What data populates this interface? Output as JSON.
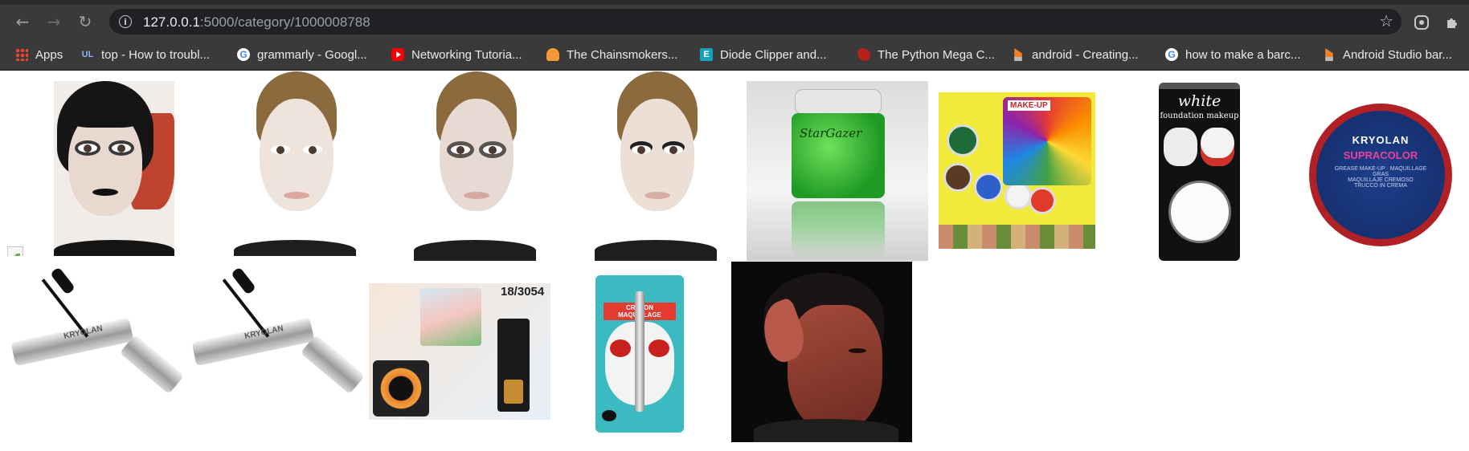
{
  "browser": {
    "url_host": "127.0.0.1",
    "url_path": ":5000/category/1000008788",
    "nav_icons": [
      "back-arrow-icon",
      "forward-arrow-icon",
      "reload-icon"
    ],
    "omnibox_icons": [
      "info-icon",
      "star-icon"
    ],
    "extension_icons": [
      "extension-app-icon",
      "puzzle-icon"
    ]
  },
  "bookmarks": [
    {
      "label": "Apps",
      "icon": "apps-grid-icon"
    },
    {
      "label": "top - How to troubl...",
      "icon": "ul-icon"
    },
    {
      "label": "grammarly - Googl...",
      "icon": "google-icon"
    },
    {
      "label": "Networking Tutoria...",
      "icon": "youtube-icon"
    },
    {
      "label": "The Chainsmokers...",
      "icon": "chainsmokers-icon"
    },
    {
      "label": "Diode Clipper and...",
      "icon": "e-icon"
    },
    {
      "label": "The Python Mega C...",
      "icon": "python-course-icon"
    },
    {
      "label": "android - Creating...",
      "icon": "stackoverflow-icon"
    },
    {
      "label": "how to make a barc...",
      "icon": "google-icon"
    },
    {
      "label": "Android Studio bar...",
      "icon": "stackoverflow-icon"
    }
  ],
  "products": {
    "items": [
      {
        "name": "goth-makeup-model"
      },
      {
        "name": "pale-foundation-model"
      },
      {
        "name": "smoky-eye-model"
      },
      {
        "name": "lashes-model"
      },
      {
        "name": "green-glitter-jar",
        "label": "StarGazer"
      },
      {
        "name": "face-paint-palette-set",
        "label": "MAKE-UP"
      },
      {
        "name": "white-foundation-makeup",
        "title": "white",
        "subtitle": "foundation makeup"
      },
      {
        "name": "kryolan-supracolor",
        "brand": "KRYOLAN",
        "product": "SUPRACOLOR",
        "desc": "GREASE MAKE-UP · MAQUILLAGE GRAS\nMAQUILLAJE CREMOSO\nTRUCCO IN CREMA"
      },
      {
        "name": "kryolan-mascara-1",
        "brand": "KRYOLAN"
      },
      {
        "name": "kryolan-mascara-2",
        "brand": "KRYOLAN"
      },
      {
        "name": "eye-makeup-kit",
        "code": "18/3054"
      },
      {
        "name": "crayon-maquillage",
        "label": "CRAYON MAQUILLAGE"
      },
      {
        "name": "elf-prosthetic-model"
      }
    ]
  }
}
